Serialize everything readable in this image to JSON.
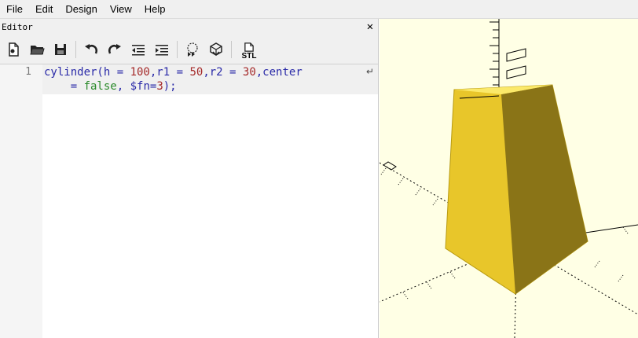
{
  "menu": [
    "File",
    "Edit",
    "Design",
    "View",
    "Help"
  ],
  "editor": {
    "title": "Editor",
    "close_glyph": "✕",
    "line_number": "1",
    "code_line1": {
      "p1": "cylinder(h = ",
      "n1": "100",
      "p2": ",r1 = ",
      "n2": "50",
      "p3": ",r2 = ",
      "n3": "30",
      "p4": ",center",
      "p5": "    = ",
      "kw": "false",
      "p6": ", $fn=",
      "n4": "3",
      "p7": ");"
    },
    "wrap_glyph": "↵"
  },
  "toolbar": {
    "icons": [
      "new-file-icon",
      "open-file-icon",
      "save-icon",
      "undo-icon",
      "redo-icon",
      "unindent-icon",
      "indent-icon",
      "preview-icon",
      "render-icon",
      "export-stl-icon"
    ],
    "stl_label": "STL"
  },
  "colors": {
    "viewport_bg": "#ffffe5",
    "model_face_front": "#e8c62a",
    "model_face_side": "#8a7417",
    "model_face_top": "#fbe96a"
  }
}
